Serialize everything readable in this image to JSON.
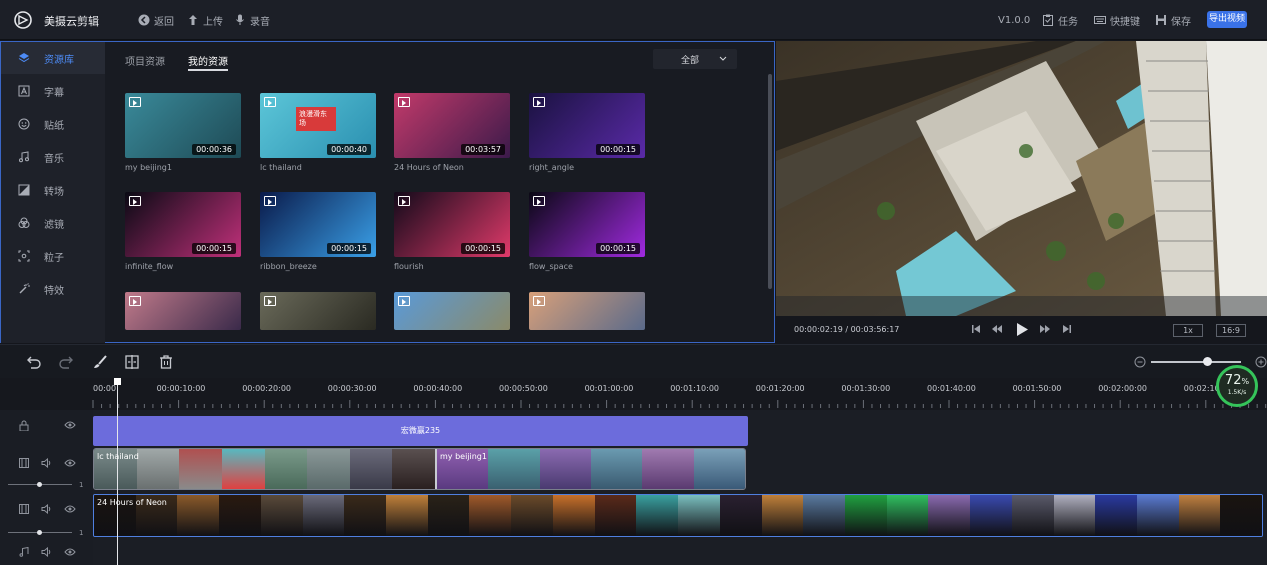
{
  "app": {
    "name": "美摄云剪辑",
    "version": "V1.0.0"
  },
  "topbar": {
    "back": "返回",
    "upload": "上传",
    "record": "录音",
    "tasks": "任务",
    "shortcuts": "快捷键",
    "save": "保存",
    "export": "导出视频"
  },
  "sidebar": {
    "items": [
      {
        "label": "资源库",
        "icon": "layers-icon"
      },
      {
        "label": "字幕",
        "icon": "text-box-icon"
      },
      {
        "label": "贴纸",
        "icon": "smile-icon"
      },
      {
        "label": "音乐",
        "icon": "music-note-icon"
      },
      {
        "label": "转场",
        "icon": "transition-icon"
      },
      {
        "label": "滤镜",
        "icon": "filter-circles-icon"
      },
      {
        "label": "粒子",
        "icon": "particle-icon"
      },
      {
        "label": "特效",
        "icon": "magic-wand-icon"
      }
    ]
  },
  "panel": {
    "tabs": [
      "项目资源",
      "我的资源"
    ],
    "active_tab": "我的资源",
    "filter": "全部",
    "resources": [
      {
        "name": "my beijing1",
        "duration": "00:00:36",
        "colors": [
          "#3a8a9a",
          "#1e4a55"
        ]
      },
      {
        "name": "lc thailand",
        "duration": "00:00:40",
        "colors": [
          "#5cc6d8",
          "#2a8fb0"
        ],
        "overlay": "浪漫滑东场"
      },
      {
        "name": "24 Hours of Neon",
        "duration": "00:03:57",
        "colors": [
          "#c23a6a",
          "#3b1a4a"
        ]
      },
      {
        "name": "right_angle",
        "duration": "00:00:15",
        "colors": [
          "#1a1240",
          "#5a2aa8"
        ]
      },
      {
        "name": "infinite_flow",
        "duration": "00:00:15",
        "colors": [
          "#0a0a14",
          "#c0307a"
        ]
      },
      {
        "name": "ribbon_breeze",
        "duration": "00:00:15",
        "colors": [
          "#0a1a4a",
          "#3aa0e8"
        ]
      },
      {
        "name": "flourish",
        "duration": "00:00:15",
        "colors": [
          "#120a1a",
          "#e03a6a"
        ]
      },
      {
        "name": "flow_space",
        "duration": "00:00:15",
        "colors": [
          "#0a0814",
          "#a02ae0"
        ]
      },
      {
        "name": "",
        "duration": "",
        "colors": [
          "#c07a8a",
          "#3a2a4a"
        ]
      },
      {
        "name": "",
        "duration": "",
        "colors": [
          "#6a6a5a",
          "#2a2a22"
        ]
      },
      {
        "name": "",
        "duration": "",
        "colors": [
          "#5a9ad8",
          "#8a8a6a"
        ]
      },
      {
        "name": "",
        "duration": "",
        "colors": [
          "#d8a07a",
          "#5a6a8a"
        ]
      }
    ]
  },
  "preview": {
    "timecode": "00:00:02:19 / 00:03:56:17",
    "speed": "1x",
    "ratio": "16:9"
  },
  "ruler": {
    "labels": [
      "00:00",
      "00:00:10:00",
      "00:00:20:00",
      "00:00:30:00",
      "00:00:40:00",
      "00:00:50:00",
      "00:01:00:00",
      "00:01:10:00",
      "00:01:20:00",
      "00:01:30:00",
      "00:01:40:00",
      "00:01:50:00",
      "00:02:00:00",
      "00:02:10:00"
    ]
  },
  "timeline": {
    "subtitle_clip": "宏微赢235",
    "v1_clip1": "lc thailand",
    "v1_clip2": "my beijing1",
    "v2_clip": "24 Hours of Neon",
    "volume_value_1": "1",
    "volume_value_2": "1"
  },
  "badge": {
    "percent": "72",
    "unit": "%",
    "speed": "1.5K/s"
  },
  "colors": {
    "accent": "#3a72e8",
    "subtitle_clip": "#6c6cdc",
    "badge_ring": "#35c45a"
  }
}
